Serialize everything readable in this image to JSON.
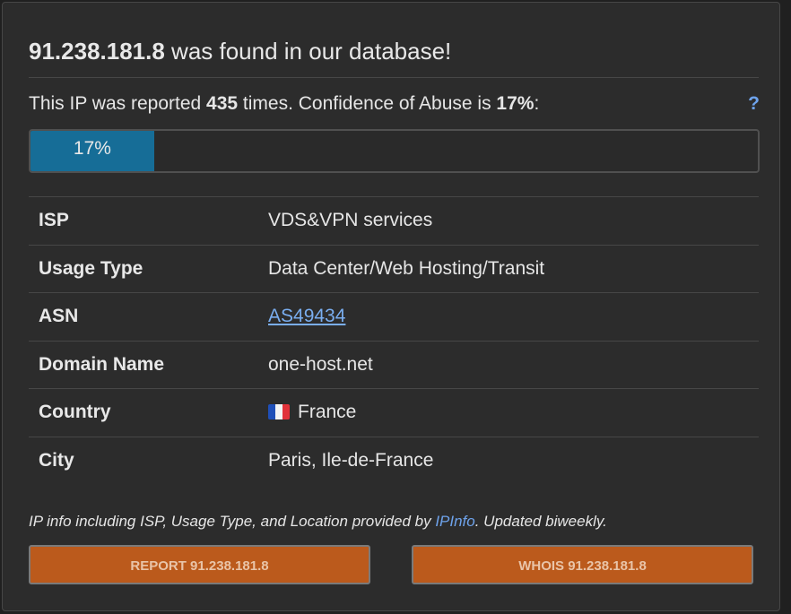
{
  "header": {
    "ip": "91.238.181.8",
    "title_rest": " was found in our database!"
  },
  "report": {
    "prefix": "This IP was reported ",
    "count": "435",
    "middle": " times. Confidence of Abuse is ",
    "confidence": "17%",
    "suffix": ":",
    "help_label": "?"
  },
  "progress": {
    "value": 17,
    "label": "17%",
    "color": "#166d97"
  },
  "details": {
    "rows": [
      {
        "label": "ISP",
        "value": "VDS&VPN services"
      },
      {
        "label": "Usage Type",
        "value": "Data Center/Web Hosting/Transit"
      },
      {
        "label": "ASN",
        "value": "AS49434"
      },
      {
        "label": "Domain Name",
        "value": "one-host.net"
      },
      {
        "label": "Country",
        "value": "France",
        "icon": "france-flag-icon"
      },
      {
        "label": "City",
        "value": "Paris, Ile-de-France"
      }
    ]
  },
  "footnote": {
    "prefix": "IP info including ISP, Usage Type, and Location provided by ",
    "link": "IPInfo",
    "suffix": ". Updated biweekly."
  },
  "buttons": {
    "report_label": "REPORT 91.238.181.8",
    "whois_label": "WHOIS 91.238.181.8",
    "color": "#bb5a1c"
  },
  "colors": {
    "link": "#6ea3ec",
    "background": "#2c2c2c"
  }
}
